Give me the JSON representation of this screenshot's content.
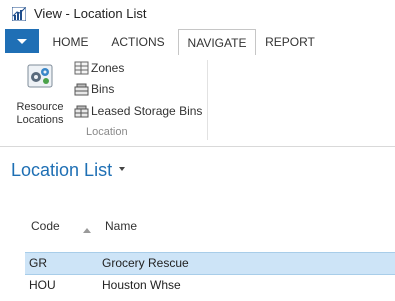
{
  "window": {
    "title": "View - Location List"
  },
  "ribbon": {
    "tabs": [
      {
        "label": "HOME"
      },
      {
        "label": "ACTIONS"
      },
      {
        "label": "NAVIGATE",
        "active": true
      },
      {
        "label": "REPORT"
      }
    ],
    "group": {
      "label": "Location",
      "big_button": {
        "label": "Resource Locations",
        "icon": "resource-locations-icon"
      },
      "small_buttons": [
        {
          "label": "Zones",
          "icon": "zones-icon"
        },
        {
          "label": "Bins",
          "icon": "bins-icon"
        },
        {
          "label": "Leased Storage Bins",
          "icon": "leased-storage-bins-icon"
        }
      ]
    }
  },
  "page": {
    "title": "Location List"
  },
  "table": {
    "columns": [
      "Code",
      "Name"
    ],
    "sort": {
      "column": "Code",
      "direction": "ascending"
    },
    "rows": [
      {
        "code": "GR",
        "name": "Grocery Rescue",
        "selected": true
      },
      {
        "code": "HOU",
        "name": "Houston Whse",
        "selected": false
      }
    ]
  },
  "colors": {
    "accent": "#1f6fb5",
    "title": "#1e6fb4",
    "selection": "#cde4f7"
  }
}
